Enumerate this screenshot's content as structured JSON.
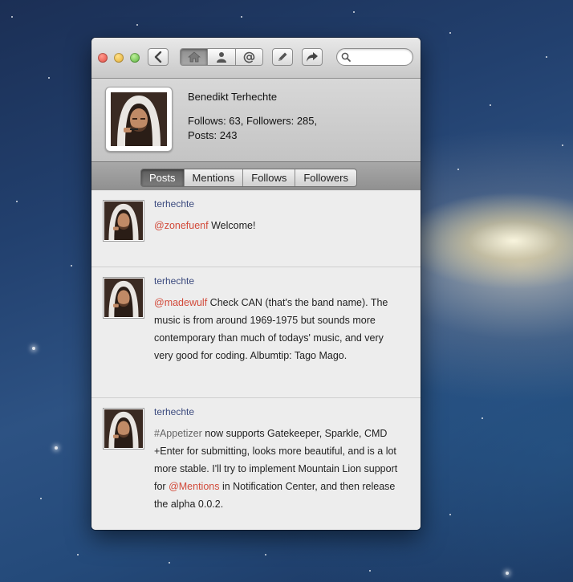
{
  "toolbar": {
    "back_icon": "chevron-left-icon",
    "home_icon": "home-icon",
    "user_icon": "user-icon",
    "mentions_icon": "at-icon",
    "compose_icon": "pencil-icon",
    "share_icon": "share-arrow-icon",
    "search_placeholder": ""
  },
  "profile": {
    "name": "Benedikt Terhechte",
    "stats_line1": "Follows: 63, Followers: 285,",
    "stats_line2": "Posts: 243"
  },
  "tabs": [
    {
      "label": "Posts",
      "active": true
    },
    {
      "label": "Mentions",
      "active": false
    },
    {
      "label": "Follows",
      "active": false
    },
    {
      "label": "Followers",
      "active": false
    }
  ],
  "posts": [
    {
      "author": "terhechte",
      "mention": "@zonefuenf",
      "text": " Welcome!"
    },
    {
      "author": "terhechte",
      "mention": "@madewulf",
      "text": " Check CAN (that's the band name). The music is from around 1969-1975 but sounds more contemporary than much of todays' music, and very very good for coding. Albumtip: Tago Mago."
    },
    {
      "author": "terhechte",
      "hashtag": "#Appetizer",
      "text_a": " now supports Gatekeeper, Sparkle, CMD +Enter for submitting, looks more beautiful, and is a lot more stable. I'll try to implement Mountain Lion support for ",
      "mention": "@Mentions",
      "text_b": " in Notification Center, and then release the alpha 0.0.2."
    }
  ]
}
